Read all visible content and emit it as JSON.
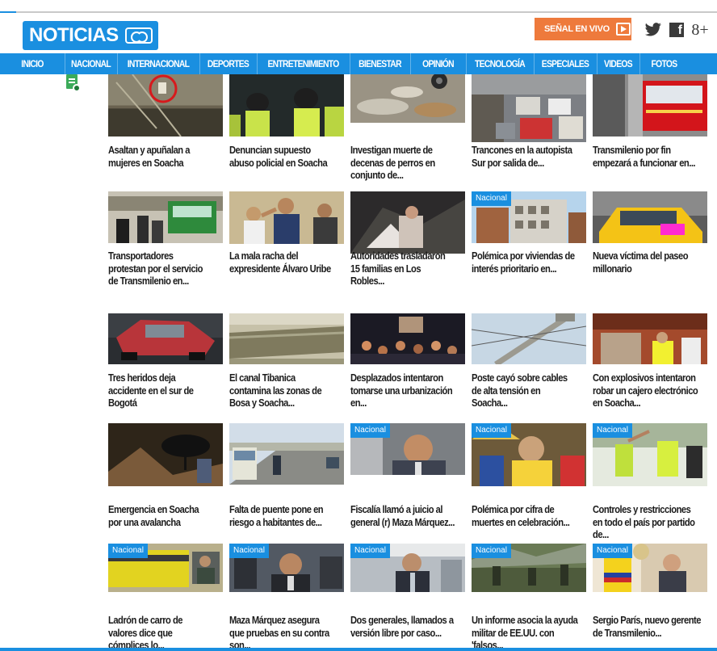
{
  "header": {
    "logo_text": "NOTICIAS",
    "live_label": "SEÑAL EN VIVO",
    "social": {
      "twitter": "twitter-icon",
      "facebook": "f",
      "gplus": "8+"
    }
  },
  "nav": {
    "items": [
      "INICIO",
      "NACIONAL",
      "INTERNACIONAL",
      "DEPORTES",
      "ENTRETENIMIENTO",
      "BIENESTAR",
      "OPINIÓN",
      "TECNOLOGÍA",
      "ESPECIALES",
      "VIDEOS",
      "FOTOS"
    ]
  },
  "colors": {
    "brand_blue": "#1a8fe0",
    "live_orange": "#ee7a3c",
    "badge_blue": "#1a8fe0",
    "headline": "#1c1c1c"
  },
  "rows": [
    {
      "cards": [
        {
          "title": "Asaltan y apuñalan a mujeres en Soacha",
          "badge": "",
          "thumb": "thumb-street-robbery"
        },
        {
          "title": "Denuncian supuesto abuso policial en Soacha",
          "badge": "",
          "thumb": "thumb-police"
        },
        {
          "title": "Investigan muerte de decenas de perros en conjunto de...",
          "badge": "",
          "thumb": "thumb-dead-dogs"
        },
        {
          "title": "Trancones en la autopista Sur por salida de...",
          "badge": "",
          "thumb": "thumb-traffic"
        },
        {
          "title": "Transmilenio por fin empezará a funcionar en...",
          "badge": "",
          "thumb": "thumb-red-bus"
        }
      ]
    },
    {
      "cards": [
        {
          "title": "Transportadores protestan por el servicio de Transmilenio en...",
          "badge": "",
          "thumb": "thumb-bus-protest"
        },
        {
          "title": "La mala racha del expresidente Álvaro Uribe",
          "badge": "",
          "thumb": "thumb-uribe"
        },
        {
          "title": "Autoridades trasladaron 15 familias en Los Robles...",
          "badge": "",
          "thumb": "thumb-families"
        },
        {
          "title": "Polémica por viviendas de interés prioritario en...",
          "badge": "Nacional",
          "thumb": "thumb-housing"
        },
        {
          "title": "Nueva víctima del paseo millonario",
          "badge": "",
          "thumb": "thumb-taxi"
        }
      ]
    },
    {
      "cards": [
        {
          "title": "Tres heridos deja accidente en el sur de Bogotá",
          "badge": "",
          "thumb": "thumb-crash"
        },
        {
          "title": "El canal Tibanica contamina las zonas de Bosa y Soacha...",
          "badge": "",
          "thumb": "thumb-canal"
        },
        {
          "title": "Desplazados intentaron tomarse una urbanización en...",
          "badge": "",
          "thumb": "thumb-night-crowd"
        },
        {
          "title": "Poste cayó sobre cables de alta tensión en Soacha...",
          "badge": "",
          "thumb": "thumb-pole"
        },
        {
          "title": "Con explosivos intentaron robar un cajero electrónico en Soacha...",
          "badge": "",
          "thumb": "thumb-atm"
        }
      ]
    },
    {
      "cards": [
        {
          "title": "Emergencia en Soacha por una avalancha",
          "badge": "",
          "thumb": "thumb-avalanche"
        },
        {
          "title": "Falta de puente pone en riesgo a habitantes de...",
          "badge": "",
          "thumb": "thumb-highway"
        },
        {
          "title": "Fiscalía llamó a juicio al general (r) Maza Márquez...",
          "badge": "Nacional",
          "thumb": "thumb-maza"
        },
        {
          "title": "Polémica por cifra de muertes en celebración...",
          "badge": "Nacional",
          "thumb": "thumb-celebration"
        },
        {
          "title": "Controles y restricciones en todo el país por partido de...",
          "badge": "Nacional",
          "thumb": "thumb-police-control"
        }
      ]
    },
    {
      "cards": [
        {
          "title": "Ladrón de carro de valores dice que cómplices lo...",
          "badge": "Nacional",
          "thumb": "thumb-armored-truck"
        },
        {
          "title": "Maza Márquez asegura que pruebas en su contra son...",
          "badge": "Nacional",
          "thumb": "thumb-maza-court"
        },
        {
          "title": "Dos generales, llamados a versión libre por caso...",
          "badge": "Nacional",
          "thumb": "thumb-general"
        },
        {
          "title": "Un informe asocia la ayuda militar de EE.UU. con 'falsos...",
          "badge": "Nacional",
          "thumb": "thumb-soldiers"
        },
        {
          "title": "Sergio París, nuevo gerente de Transmilenio...",
          "badge": "Nacional",
          "thumb": "thumb-paris"
        }
      ]
    }
  ]
}
